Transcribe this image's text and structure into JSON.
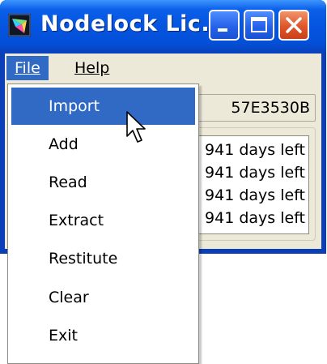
{
  "window": {
    "title": "Nodelock Lic..."
  },
  "menubar": {
    "items": [
      {
        "label": "File"
      },
      {
        "label": "Help"
      }
    ]
  },
  "content": {
    "host_id": "57E3530B",
    "license_rows": [
      "941 days left",
      "941 days left",
      "941 days left",
      "941 days left"
    ]
  },
  "file_menu": {
    "items": [
      {
        "label": "Import",
        "state": "highlighted"
      },
      {
        "label": "Add"
      },
      {
        "label": "Read"
      },
      {
        "label": "Extract"
      },
      {
        "label": "Restitute"
      },
      {
        "label": "Clear"
      },
      {
        "label": "Exit"
      }
    ]
  },
  "colors": {
    "titlebar_blue": "#0454e0",
    "menu_highlight": "#316ac5",
    "window_face": "#ece9d8",
    "close_button": "#e0552a"
  }
}
